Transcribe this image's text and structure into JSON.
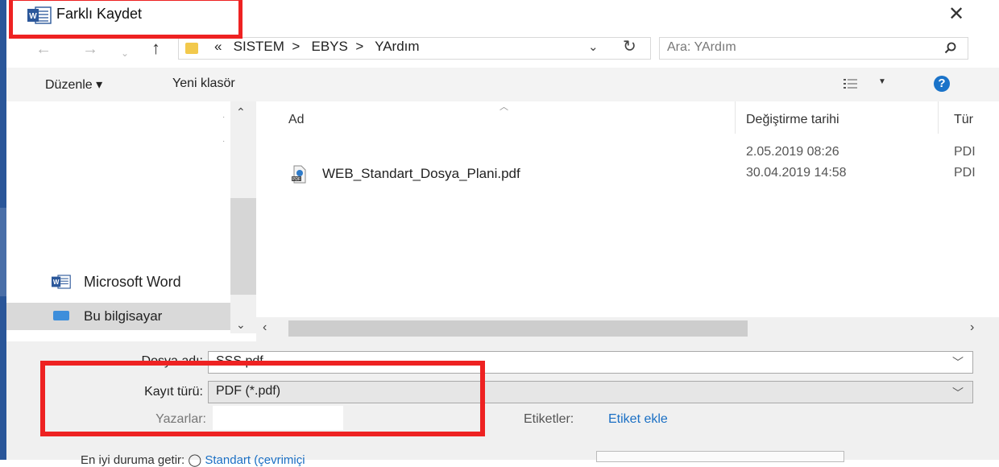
{
  "window": {
    "title": "Farklı Kaydet",
    "app_icon": "word-icon",
    "close_icon": "close-icon"
  },
  "nav": {
    "back_icon": "arrow-left-icon",
    "forward_icon": "arrow-right-icon",
    "recent_icon": "chevron-down-icon",
    "up_icon": "arrow-up-icon",
    "breadcrumb": [
      "SISTEM",
      "EBYS",
      "YArdım"
    ],
    "breadcrumb_overflow": "«",
    "breadcrumb_sep": ">",
    "search_placeholder": "Ara: YArdım"
  },
  "toolbar": {
    "organize": "Düzenle ▾",
    "new_folder": "Yeni klasör",
    "help": "?"
  },
  "left_pane": {
    "items": [
      {
        "label": "Microsoft Word",
        "icon": "word-icon"
      },
      {
        "label": "Bu bilgisayar",
        "icon": "computer-icon",
        "selected": true
      }
    ]
  },
  "file_list": {
    "columns": [
      "Ad",
      "Değiştirme tarihi",
      "Tür"
    ],
    "rows": [
      {
        "name": "",
        "modified": "2.05.2019 08:26",
        "type": "PDI"
      },
      {
        "name": "WEB_Standart_Dosya_Plani.pdf",
        "modified": "30.04.2019 14:58",
        "type": "PDI"
      }
    ]
  },
  "form": {
    "filename_label": "Dosya adı:",
    "filename_value": "SSS.pdf",
    "savetype_label": "Kayıt türü:",
    "savetype_value": "PDF (*.pdf)",
    "authors_label": "Yazarlar:",
    "authors_value": "",
    "tags_label": "Etiketler:",
    "tags_link": "Etiket ekle",
    "optimize_label": "En iyi duruma getir:",
    "optimize_option": "Standart (çevrimiçi"
  },
  "colors": {
    "accent_blue": "#2a5699",
    "annotation_red": "#ee2222",
    "link_blue": "#1a6fc4"
  }
}
